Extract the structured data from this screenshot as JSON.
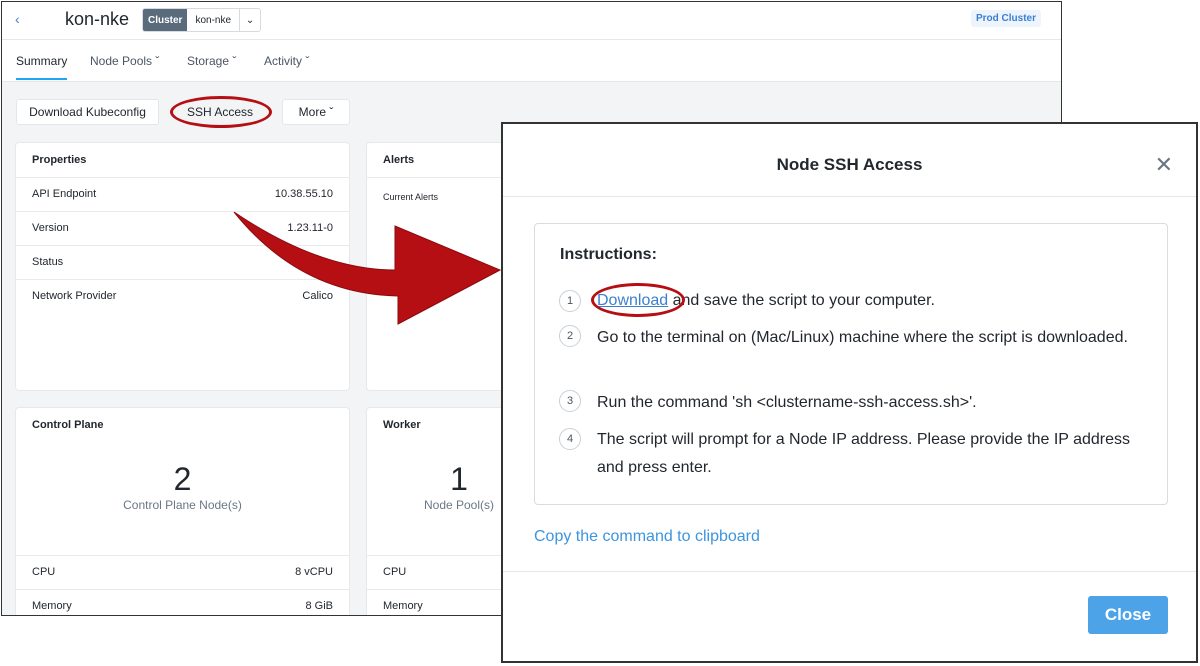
{
  "header": {
    "back_icon": "chevron-left-icon",
    "title": "kon-nke",
    "cluster_tag": "Cluster",
    "cluster_value": "kon-nke",
    "badge": "Prod Cluster"
  },
  "tabs": [
    {
      "label": "Summary"
    },
    {
      "label": "Node Pools"
    },
    {
      "label": "Storage"
    },
    {
      "label": "Activity"
    }
  ],
  "actions": {
    "download": "Download Kubeconfig",
    "ssh": "SSH Access",
    "more": "More"
  },
  "properties": {
    "title": "Properties",
    "rows": [
      {
        "key": "API Endpoint",
        "value": "10.38.55.10"
      },
      {
        "key": "Version",
        "value": "1.23.11-0"
      },
      {
        "key": "Status",
        "value": ""
      },
      {
        "key": "Network Provider",
        "value": "Calico"
      }
    ]
  },
  "alerts": {
    "title": "Alerts",
    "current": "Current Alerts"
  },
  "control_plane": {
    "title": "Control Plane",
    "count": "2",
    "label": "Control Plane Node(s)",
    "rows": [
      {
        "key": "CPU",
        "value": "8 vCPU"
      },
      {
        "key": "Memory",
        "value": "8 GiB"
      }
    ]
  },
  "worker": {
    "title": "Worker",
    "count": "1",
    "label": "Node Pool(s)",
    "rows": [
      {
        "key": "CPU"
      },
      {
        "key": "Memory"
      }
    ]
  },
  "modal": {
    "title": "Node SSH Access",
    "close_icon": "close-icon",
    "instructions_title": "Instructions:",
    "steps": [
      {
        "num": "1",
        "link": "Download",
        "text": " and save the script to your computer."
      },
      {
        "num": "2",
        "text": "Go to the terminal on (Mac/Linux) machine where the script is downloaded."
      },
      {
        "num": "3",
        "text": "Run the command 'sh <clustername-ssh-access.sh>'."
      },
      {
        "num": "4",
        "text": "The script will prompt for a Node IP address. Please provide the IP address and press enter."
      }
    ],
    "copy_link": "Copy the command to clipboard",
    "close_button": "Close"
  },
  "colors": {
    "accent": "#4da3e8",
    "link": "#3b7fd1",
    "callout": "#b50f14"
  }
}
